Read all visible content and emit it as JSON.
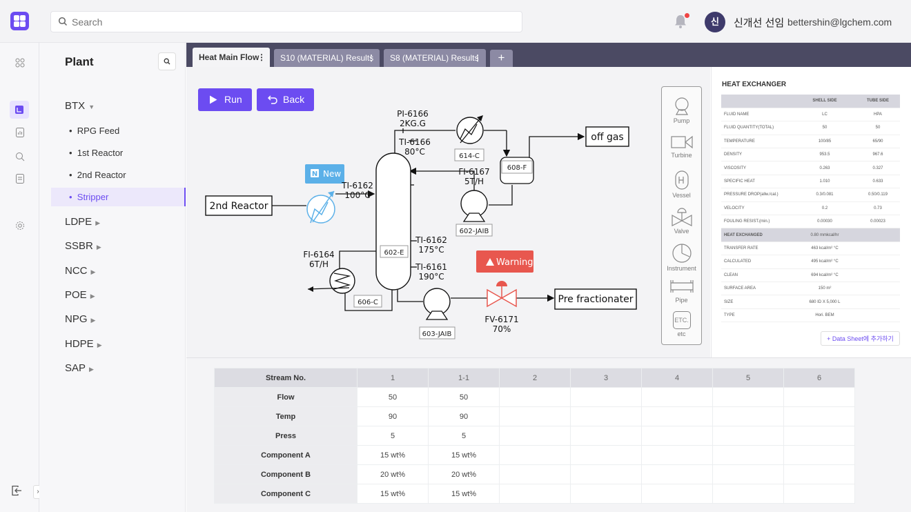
{
  "search": {
    "placeholder": "Search"
  },
  "user": {
    "avatar_initial": "신",
    "name": "신개선 선임",
    "email": "bettershin@lgchem.com"
  },
  "plant": {
    "title": "Plant",
    "groups": [
      {
        "label": "BTX",
        "expanded": true,
        "items": [
          "RPG Feed",
          "1st Reactor",
          "2nd Reactor",
          "Stripper"
        ],
        "active": "Stripper"
      },
      {
        "label": "LDPE"
      },
      {
        "label": "SSBR"
      },
      {
        "label": "NCC"
      },
      {
        "label": "POE"
      },
      {
        "label": "NPG"
      },
      {
        "label": "HDPE"
      },
      {
        "label": "SAP"
      }
    ]
  },
  "tabs": [
    {
      "label": "Heat Main Flow",
      "active": true
    },
    {
      "label": "S10 (MATERIAL) Results"
    },
    {
      "label": "S8 (MATERIAL) Results"
    }
  ],
  "tab_add": "+",
  "toolbar": {
    "run": "Run",
    "back": "Back"
  },
  "diagram": {
    "input_box": "2nd Reactor",
    "off_gas": "off gas",
    "pre_frac": "Pre fractionater",
    "pi_6166": "PI-6166",
    "pi_6166_val": "2KG.G",
    "ti_6166": "TI-6166",
    "ti_6166_val": "80°C",
    "ti_6162a": "TI-6162",
    "ti_6162a_val": "100°C",
    "ti_6162b": "TI-6162",
    "ti_6162b_val": "175°C",
    "ti_6161": "TI-6161",
    "ti_6161_val": "190°C",
    "fi_6167": "FI-6167",
    "fi_6167_val": "5T/H",
    "fi_6164": "FI-6164",
    "fi_6164_val": "6T/H",
    "fv_6171": "FV-6171",
    "fv_6171_val": "70%",
    "tag_614c": "614-C",
    "tag_608f": "608-F",
    "tag_602jaib": "602-JAIB",
    "tag_602e": "602-E",
    "tag_606c": "606-C",
    "tag_603jaib": "603-JAIB",
    "new_badge": "New",
    "new_badge_letter": "N",
    "warning_badge": "Warning",
    "colors": {
      "accent": "#6c4cf1",
      "new": "#5bb0e8",
      "warning": "#e8574e"
    }
  },
  "palette": [
    {
      "label": "Pump",
      "icon": "pump-icon"
    },
    {
      "label": "Turbine",
      "icon": "turbine-icon"
    },
    {
      "label": "Vessel",
      "icon": "vessel-icon"
    },
    {
      "label": "Valve",
      "icon": "valve-icon"
    },
    {
      "label": "Instrument",
      "icon": "instrument-icon"
    },
    {
      "label": "Pipe",
      "icon": "pipe-icon"
    },
    {
      "label": "etc",
      "icon": "etc-icon",
      "glyph": "ETC."
    }
  ],
  "heat_exchanger": {
    "title": "HEAT EXCHANGER",
    "col_shell": "SHELL SIDE",
    "col_tube": "TUBE SIDE",
    "rows": [
      {
        "label": "FLUID NAME",
        "shell": "LC",
        "tube": "HPA"
      },
      {
        "label": "FLUID QUANTITY(TOTAL)",
        "shell": "50",
        "tube": "50"
      },
      {
        "label": "TEMPERATURE",
        "shell": "100/85",
        "tube": "65/90"
      },
      {
        "label": "DENSITY",
        "shell": "953.5",
        "tube": "967.6"
      },
      {
        "label": "VISCOSITY",
        "shell": "0.263",
        "tube": "0.327"
      },
      {
        "label": "SPECIFIC HEAT",
        "shell": "1.010",
        "tube": "0.633"
      },
      {
        "label": "PRESSURE DROP(allw./cal.)",
        "shell": "0.3/0.081",
        "tube": "0.50/0.119"
      },
      {
        "label": "VELOCITY",
        "shell": "0.2",
        "tube": "0.73"
      },
      {
        "label": "FOULING RESIST.(min.)",
        "shell": "0.00030",
        "tube": "0.00023"
      }
    ],
    "exchanged_label": "HEAT EXCHANGED",
    "exchanged_value": "0.80 mmkcal/hr",
    "rows2": [
      {
        "label": "TRANSFER RATE",
        "value": "463 kcal/m² °C"
      },
      {
        "label": "CALCULATED",
        "value": "495 kcal/m² °C"
      },
      {
        "label": "CLEAN",
        "value": "694 kcal/m² °C"
      },
      {
        "label": "SURFACE AREA",
        "value": "150 m²"
      },
      {
        "label": "SIZE",
        "value": "680 ID X 5,000 L"
      },
      {
        "label": "TYPE",
        "value": "Hori. BEM"
      }
    ],
    "add_button": "+ Data Sheet에 추가하기"
  },
  "stream_table": {
    "header": "Stream No.",
    "columns": [
      "1",
      "1-1",
      "2",
      "3",
      "4",
      "5",
      "6"
    ],
    "rows": [
      {
        "label": "Flow",
        "values": [
          "50",
          "50",
          "",
          "",
          "",
          "",
          ""
        ]
      },
      {
        "label": "Temp",
        "values": [
          "90",
          "90",
          "",
          "",
          "",
          "",
          ""
        ]
      },
      {
        "label": "Press",
        "values": [
          "5",
          "5",
          "",
          "",
          "",
          "",
          ""
        ]
      },
      {
        "label": "Component A",
        "values": [
          "15 wt%",
          "15 wt%",
          "",
          "",
          "",
          "",
          ""
        ]
      },
      {
        "label": "Component B",
        "values": [
          "20 wt%",
          "20 wt%",
          "",
          "",
          "",
          "",
          ""
        ]
      },
      {
        "label": "Component C",
        "values": [
          "15 wt%",
          "15 wt%",
          "",
          "",
          "",
          "",
          ""
        ]
      }
    ]
  }
}
